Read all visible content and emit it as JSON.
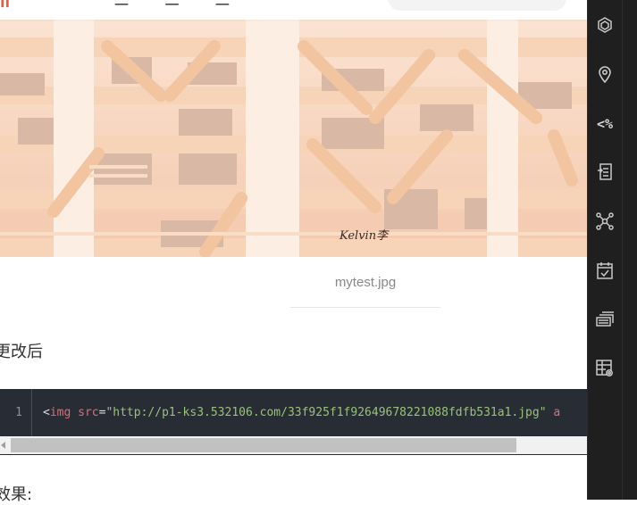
{
  "header": {
    "logo_fragment": "jj",
    "title_fragment": "一 一 一"
  },
  "article": {
    "image_watermark": "Kelvin李",
    "image_caption": "mytest.jpg",
    "paragraph_after_image": "更改后",
    "code_block": {
      "line_number": "1",
      "tokens": {
        "open": "<",
        "tag": "img",
        "attr": "src",
        "equals": "=",
        "value": "\"http://p1-ks3.532106.com/33f925f1f92649678221088fdfb531a1.jpg\"",
        "trailing": "a"
      }
    },
    "paragraph_after_code": "效果:"
  },
  "right_sidebar": {
    "items": [
      {
        "icon": "chatgpt-icon"
      },
      {
        "icon": "location-pin-icon"
      },
      {
        "icon": "percent-code-icon",
        "label": "<%"
      },
      {
        "icon": "document-export-icon"
      },
      {
        "icon": "network-graph-icon"
      },
      {
        "icon": "calendar-check-icon"
      },
      {
        "icon": "cards-stack-icon"
      },
      {
        "icon": "table-settings-icon"
      }
    ]
  },
  "colors": {
    "accent": "#f05a3a",
    "code_bg": "#282c34",
    "code_string": "#98c379",
    "code_tag": "#e06c75",
    "sidebar_bg": "#1f1f1f"
  }
}
